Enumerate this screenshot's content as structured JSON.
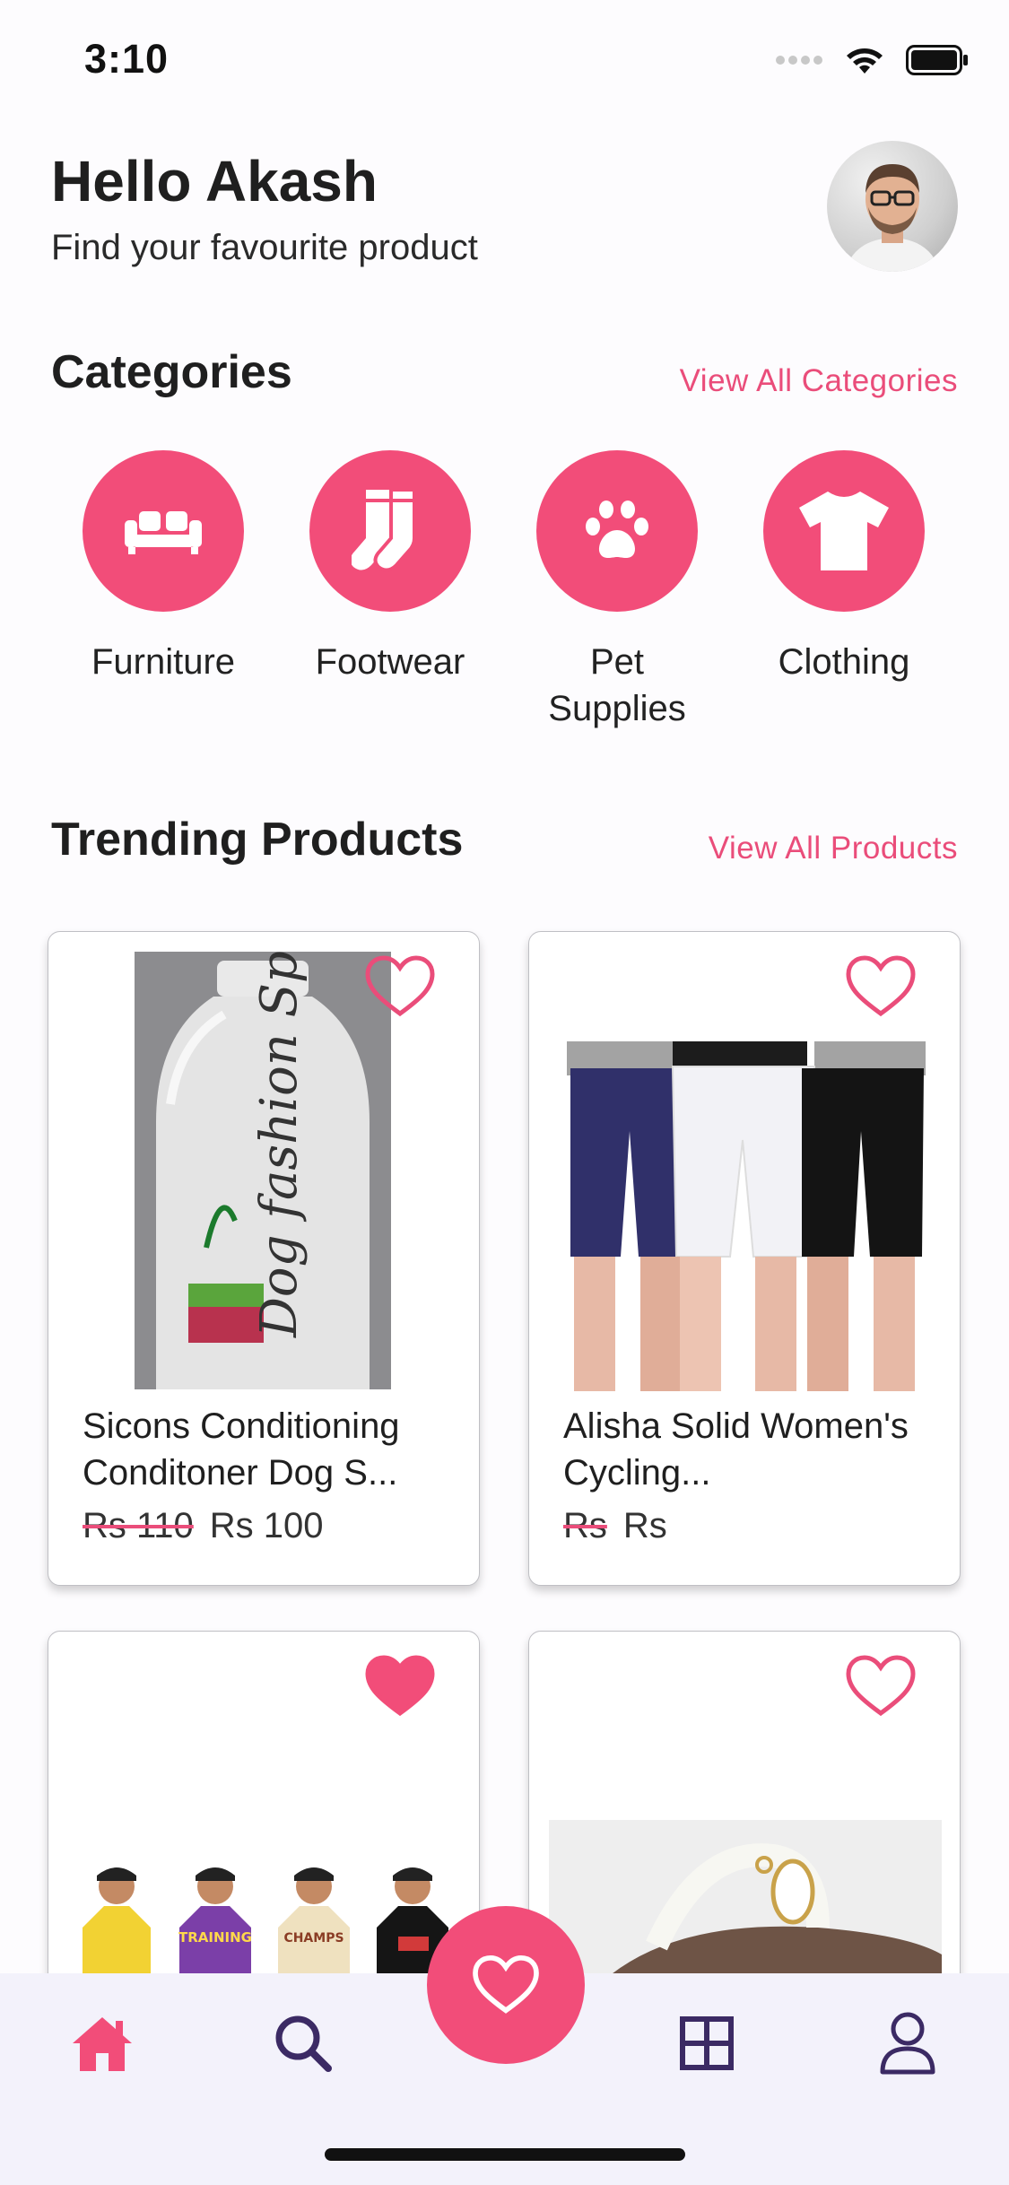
{
  "status_bar": {
    "time": "3:10"
  },
  "header": {
    "greeting": "Hello Akash",
    "subtitle": "Find your favourite product",
    "avatar_icon": "user-avatar"
  },
  "categories": {
    "title": "Categories",
    "view_all": "View All Categories",
    "items": [
      {
        "label": "Furniture",
        "icon": "sofa-icon"
      },
      {
        "label": "Footwear",
        "icon": "socks-icon"
      },
      {
        "label": "Pet Supplies",
        "icon": "paw-icon"
      },
      {
        "label": "Clothing",
        "icon": "tshirt-icon"
      }
    ]
  },
  "trending": {
    "title": "Trending Products",
    "view_all": "View All Products",
    "products": [
      {
        "name": "Sicons Conditioning Conditoner Dog S...",
        "old_price": "Rs 110",
        "price": "Rs 100",
        "favourite": false,
        "image_text": "Dog fashion Spa"
      },
      {
        "name": "Alisha Solid Women's Cycling...",
        "old_price": "Rs",
        "price": "Rs",
        "favourite": false
      },
      {
        "name": "",
        "old_price": "",
        "price": "",
        "favourite": true,
        "image_shirt_text": [
          "TRAINING",
          "CHAMPS"
        ]
      },
      {
        "name": "",
        "old_price": "",
        "price": "",
        "favourite": false
      }
    ]
  },
  "tabbar": {
    "tabs": [
      "home-icon",
      "search-icon",
      "favourites-icon",
      "grid-icon",
      "profile-icon"
    ],
    "active": "home-icon"
  },
  "colors": {
    "accent": "#f24d79",
    "link": "#ea4d7a",
    "tab_inactive": "#3b2a64"
  }
}
